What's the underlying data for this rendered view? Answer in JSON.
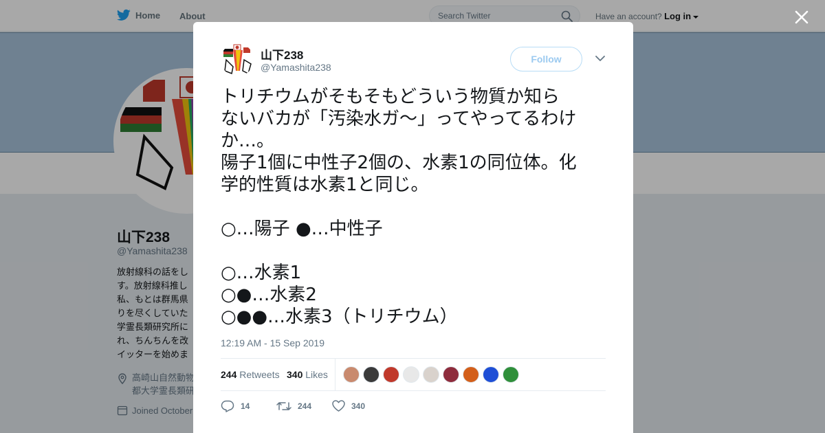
{
  "topbar": {
    "home_label": "Home",
    "about_label": "About",
    "search_placeholder": "Search Twitter",
    "account_prompt": "Have an account?",
    "login_label": "Log in"
  },
  "background_profile": {
    "name": "山下238",
    "handle": "@Yamashita238",
    "bio_lines": [
      "放射線科の話をし",
      "す。放射線科推し",
      "私、もとは群馬県",
      "りを尽くしていた",
      "学霊長類研究所に",
      "れ、ちんちんを改",
      "イッターを始めま"
    ],
    "location_lines": [
      "高崎山自然動物",
      "都大学霊長類研"
    ],
    "joined": "Joined October"
  },
  "tweet": {
    "author_name": "山下238",
    "author_handle": "@Yamashita238",
    "follow_label": "Follow",
    "text_lines": [
      "トリチウムがそもそもどういう物質か知ら",
      "ないバカが「汚染水ガ～」ってやってるわけ",
      "か…。",
      "陽子1個に中性子2個の、水素1の同位体。化",
      "学的性質は水素1と同じ。",
      "",
      "○…陽子 ●…中性子",
      "",
      "○…水素1",
      "○●…水素2",
      "○●●…水素3（トリチウム）"
    ],
    "timestamp": "12:19 AM - 15 Sep 2019",
    "retweets_count": "244",
    "retweets_label": "Retweets",
    "likes_count": "340",
    "likes_label": "Likes",
    "reply_count": "14",
    "retweet_action_count": "244",
    "like_action_count": "340"
  },
  "liker_avatar_colors": [
    "#c98a6e",
    "#3a3a3a",
    "#c0392b",
    "#e8e8e8",
    "#d9d2cc",
    "#8e2c3c",
    "#d35f1a",
    "#1f4fd6",
    "#2f8f3a"
  ],
  "colors": {
    "twitter_blue": "#1da1f2",
    "follow_border": "#b7dcf6",
    "banner": "#a9c4dd"
  },
  "icons": [
    "twitter-bird-icon",
    "search-icon",
    "caret-down-icon",
    "close-icon",
    "chevron-down-icon",
    "reply-icon",
    "retweet-icon",
    "heart-icon",
    "location-icon",
    "calendar-icon"
  ]
}
